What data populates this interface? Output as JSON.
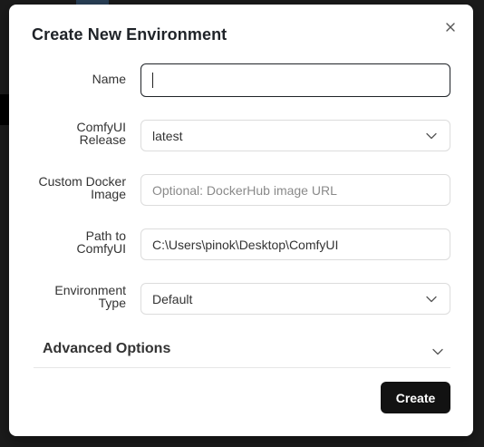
{
  "dialog": {
    "title": "Create New Environment",
    "close_icon": "close-icon"
  },
  "fields": {
    "name": {
      "label": "Name",
      "value": ""
    },
    "release": {
      "label_line1": "ComfyUI",
      "label_line2": "Release",
      "value": "latest",
      "icon": "chevron-down-icon"
    },
    "docker": {
      "label_line1": "Custom Docker",
      "label_line2": "Image",
      "placeholder": "Optional: DockerHub image URL",
      "value": ""
    },
    "path": {
      "label_line1": "Path to",
      "label_line2": "ComfyUI",
      "value": "C:\\Users\\pinok\\Desktop\\ComfyUI"
    },
    "env_type": {
      "label_line1": "Environment",
      "label_line2": "Type",
      "value": "Default",
      "icon": "chevron-down-icon"
    }
  },
  "advanced": {
    "label": "Advanced Options",
    "icon": "chevron-down-icon"
  },
  "actions": {
    "create_label": "Create"
  },
  "colors": {
    "primary_button": "#121212",
    "focus_border": "#1f2328",
    "field_border": "#dcdcdc",
    "backdrop": "#1b1b1b"
  }
}
